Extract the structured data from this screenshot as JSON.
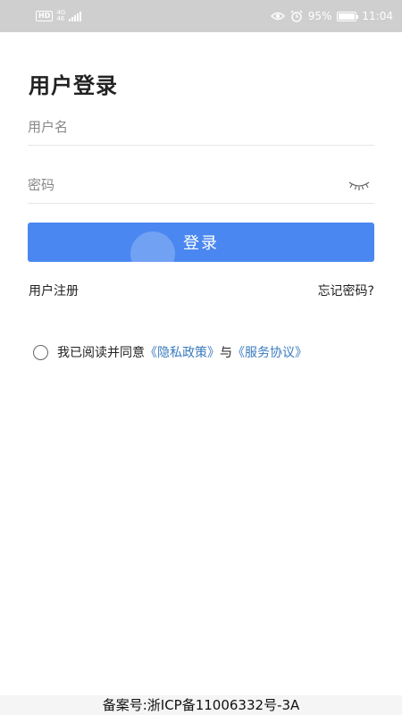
{
  "status_bar": {
    "hd_badge": "HD",
    "network_top": "4G",
    "network_bottom": "46",
    "battery_percent": "95%",
    "battery_level": 0.95,
    "time": "11:04",
    "icons": [
      "eye-icon",
      "alarm-icon",
      "battery-icon",
      "signal-icon"
    ]
  },
  "login": {
    "title": "用户登录",
    "username_placeholder": "用户名",
    "password_placeholder": "密码",
    "submit_label": "登录"
  },
  "links": {
    "register": "用户注册",
    "forgot_password": "忘记密码?"
  },
  "agreement": {
    "prefix": "我已阅读并同意",
    "privacy_policy": "《隐私政策》",
    "connector": "与",
    "service_agreement": "《服务协议》"
  },
  "footer": {
    "icp": "备案号:浙ICP备11006332号-3A"
  },
  "colors": {
    "accent": "#4a87f0",
    "link": "#3a7bbf",
    "status_bar_bg": "#cfcfcf"
  }
}
